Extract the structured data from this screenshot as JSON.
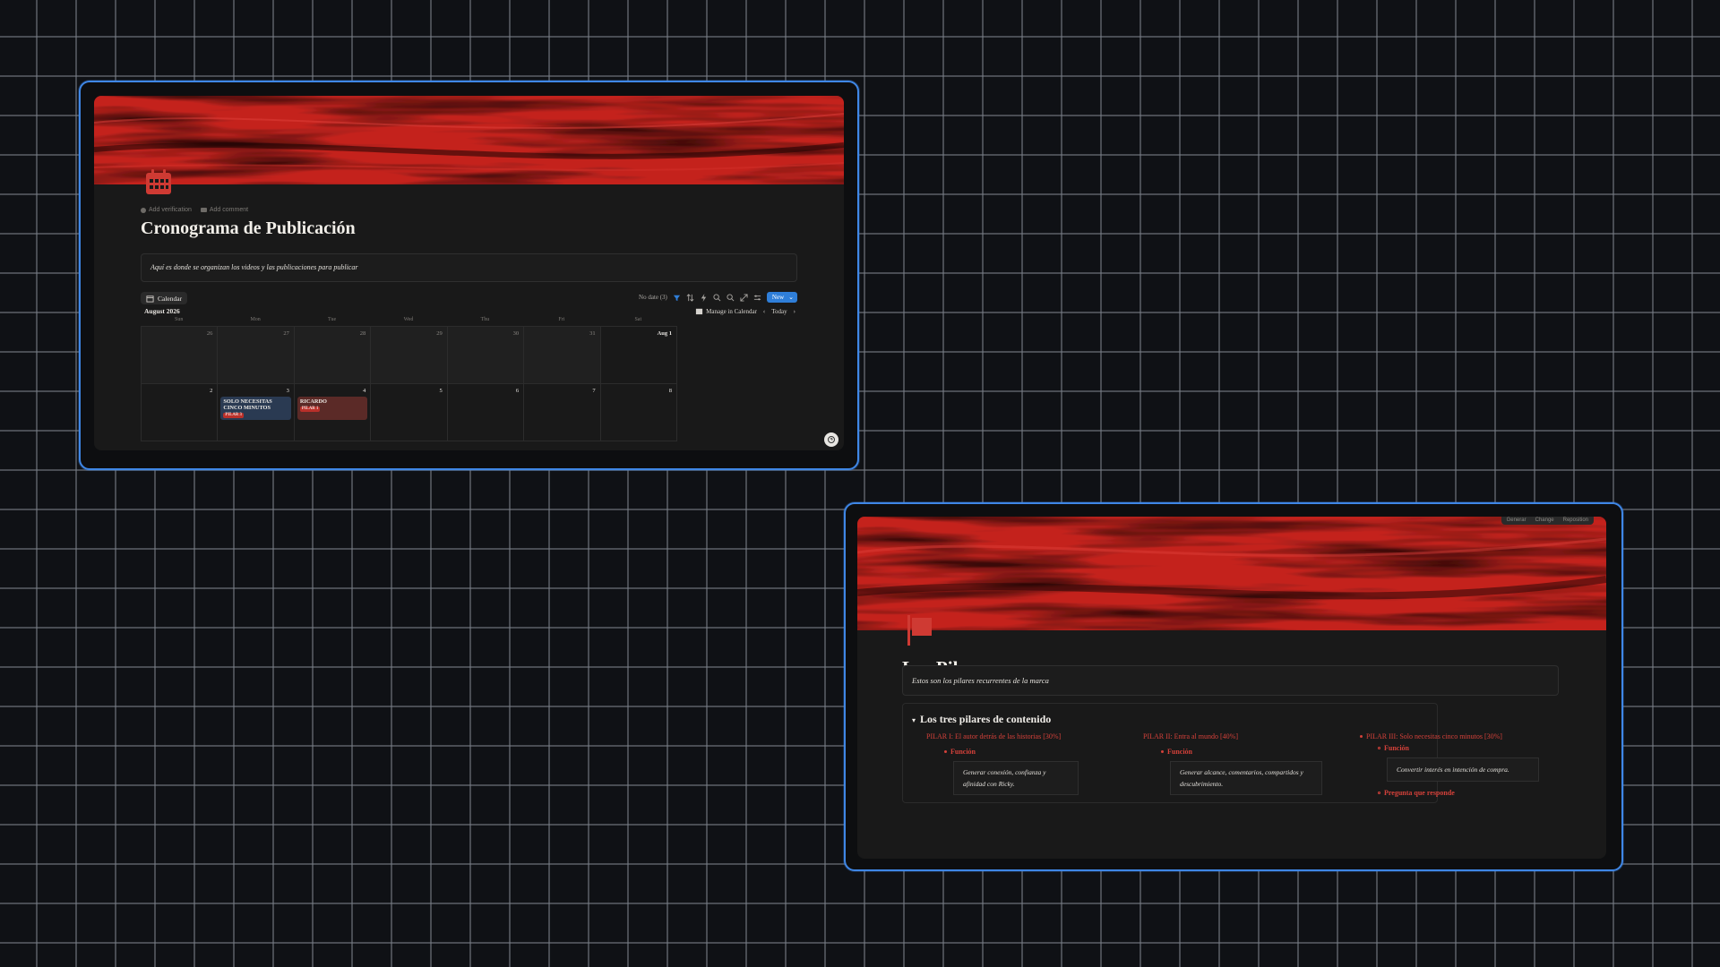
{
  "calendar_page": {
    "meta": {
      "verification": "Add verification",
      "comment": "Add comment"
    },
    "title": "Cronograma de Publicación",
    "description": "Aquí es donde se organizan los videos y las publicaciones para publicar",
    "view_tab": "Calendar",
    "toolbar": {
      "no_date": "No date (3)",
      "new_label": "New"
    },
    "month_label": "August 2026",
    "manage_label": "Manage in Calendar",
    "today_label": "Today",
    "weekdays": [
      "Sun",
      "Mon",
      "Tue",
      "Wed",
      "Thu",
      "Fri",
      "Sat"
    ],
    "week1": [
      "26",
      "27",
      "28",
      "29",
      "30",
      "31",
      "Aug 1"
    ],
    "week2": [
      "2",
      "3",
      "4",
      "5",
      "6",
      "7",
      "8"
    ],
    "events": [
      {
        "title": "SOLO NECESITAS CINCO MINUTOS",
        "tag": "PILAR 3",
        "color": "#2a3a52"
      },
      {
        "title": "RICARDO",
        "tag": "PILAR 1",
        "color": "#5b2a27"
      }
    ],
    "icon": "calendar-icon"
  },
  "pilares_page": {
    "top_bar": [
      "Generar",
      "Change",
      "Reposition"
    ],
    "title": "Los Pilares",
    "description": "Estos son los pilares recurrentes de la marca",
    "toggle_heading": "Los tres pilares de contenido",
    "pillars": [
      {
        "title": "PILAR I: El autor detrás de las historias [30%]",
        "label": "Función",
        "text": "Generar conexión, confianza y afinidad con Ricky."
      },
      {
        "title": "PILAR II: Entra al mundo [40%]",
        "label": "Función",
        "text": "Generar alcance, comentarios, compartidos y descubrimiento."
      },
      {
        "title": "PILAR III: Solo necesitas cinco minutos [30%]",
        "label": "Función",
        "text": "Convertir interés en intención de compra.",
        "extra": "Pregunta que responde"
      }
    ],
    "icon": "flag-icon"
  },
  "colors": {
    "accent": "#d4413a",
    "frame": "#3f87e6",
    "button": "#2f7ed8"
  }
}
